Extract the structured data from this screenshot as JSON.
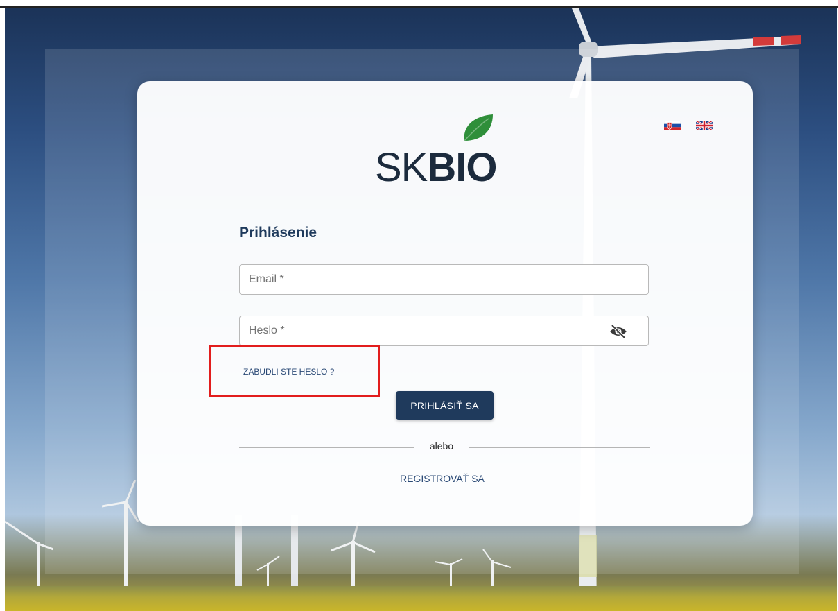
{
  "logo": {
    "text_light": "SK",
    "text_bold": "BIO",
    "leaf_icon": "leaf-icon",
    "leaf_color": "#2f8f3a"
  },
  "languages": [
    {
      "code": "sk",
      "icon": "slovak-flag-icon"
    },
    {
      "code": "en",
      "icon": "uk-flag-icon"
    }
  ],
  "form": {
    "title": "Prihlásenie",
    "email_placeholder": "Email *",
    "email_value": "",
    "password_placeholder": "Heslo *",
    "password_value": "",
    "password_toggle_icon": "eye-off-icon",
    "forgot_label": "ZABUDLI STE HESLO ?",
    "login_label": "PRIHLÁSIŤ SA",
    "or_label": "alebo",
    "register_label": "REGISTROVAŤ SA"
  },
  "colors": {
    "primary": "#1f3a5c",
    "link": "#2b4a76",
    "highlight": "#e21d1d"
  }
}
